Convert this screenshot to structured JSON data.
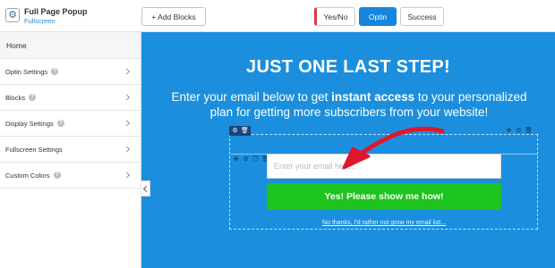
{
  "app": {
    "title": "Full Page Popup",
    "subtitle": "Fullscreen",
    "icon": "gear-icon"
  },
  "toolbar": {
    "add_blocks_label": "+ Add Blocks",
    "tabs": [
      {
        "label": "Yes/No",
        "state": "inactive"
      },
      {
        "label": "Optin",
        "state": "active"
      },
      {
        "label": "Success",
        "state": "inactive"
      }
    ]
  },
  "sidebar": {
    "home_label": "Home",
    "items": [
      {
        "label": "Optin Settings"
      },
      {
        "label": "Blocks"
      },
      {
        "label": "Display Settings"
      },
      {
        "label": "Fullscreen Settings"
      },
      {
        "label": "Custom Colors"
      }
    ]
  },
  "canvas": {
    "headline": "JUST ONE LAST STEP!",
    "subtext_part1": "Enter your email below to get ",
    "subtext_bold": "instant access",
    "subtext_part2": " to your personalized plan for getting more subscribers from your website!",
    "email_placeholder": "Enter your email here...",
    "submit_label": "Yes! Please show me how!",
    "decline_label": "No thanks, I'd rather not grow my email list...",
    "background_color": "#1b8fdd",
    "button_color": "#1ec41e",
    "annotation_color": "#e0162b"
  }
}
